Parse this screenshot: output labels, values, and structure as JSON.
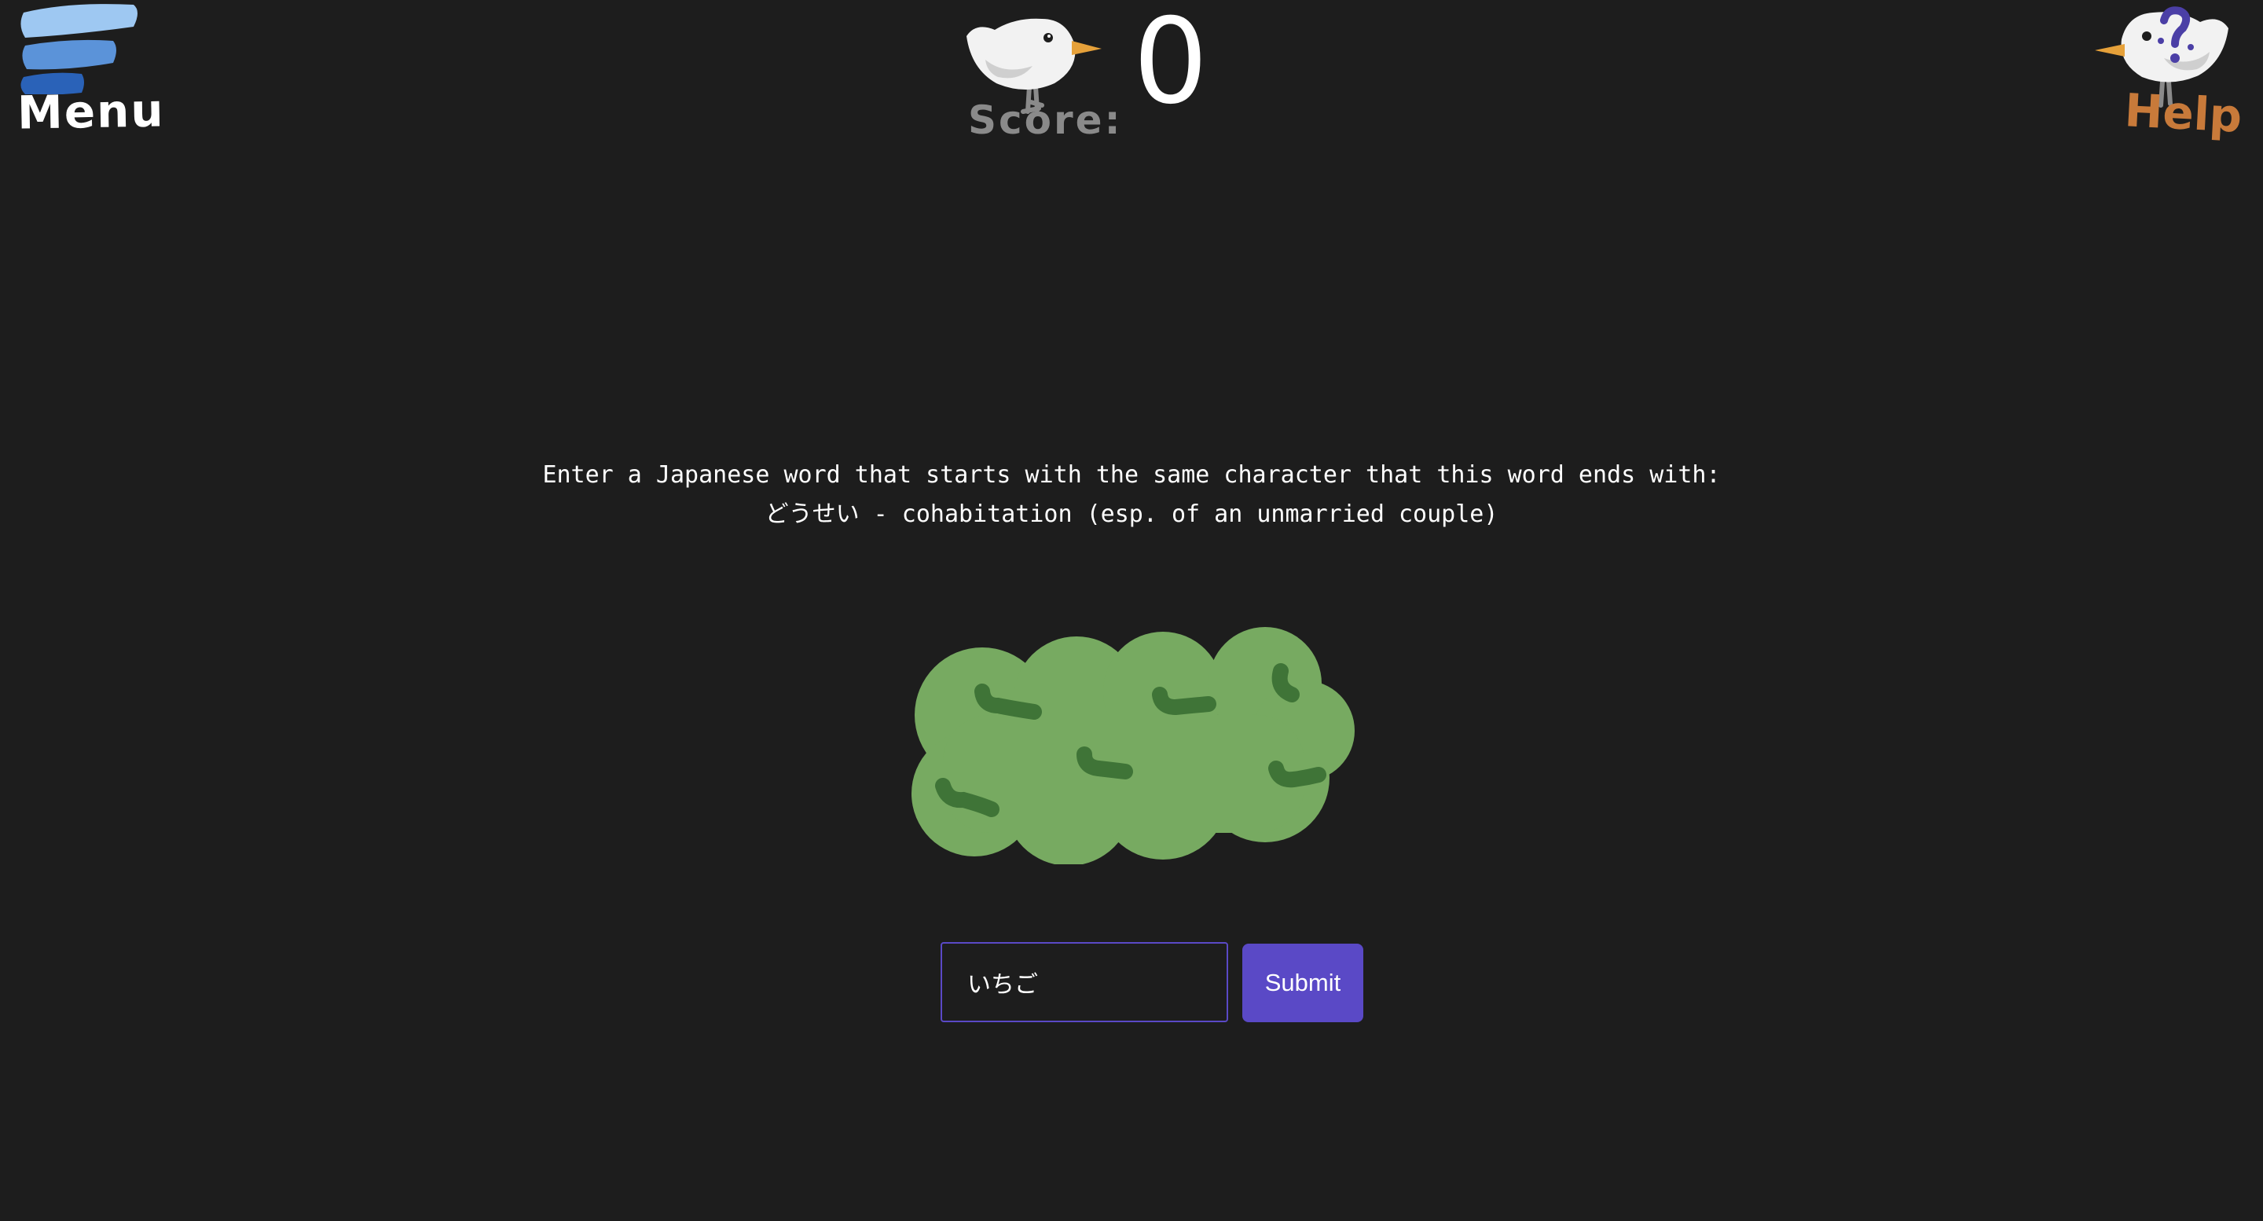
{
  "header": {
    "menu_label": "Menu",
    "score_label": "Score:",
    "score_value": "0",
    "help_label": "Help"
  },
  "prompt": {
    "instruction": "Enter a Japanese word that starts with the same character that this word ends with:",
    "word_line": "どうせい - cohabitation (esp. of an unmarried couple)"
  },
  "form": {
    "input_value": "いちご",
    "submit_label": "Submit"
  },
  "colors": {
    "background": "#1d1d1d",
    "accent": "#5a49c6",
    "help": "#c87a3a",
    "bush": "#77aa61",
    "bush_dark": "#3f7437",
    "menu_light": "#9ec8f2",
    "menu_mid": "#5b93d9",
    "menu_dark": "#2a62b8"
  },
  "icons": {
    "menu": "hamburger-menu-icon",
    "score_bird": "bird-icon",
    "help_bird": "bird-question-icon",
    "bush": "bush-illustration"
  }
}
